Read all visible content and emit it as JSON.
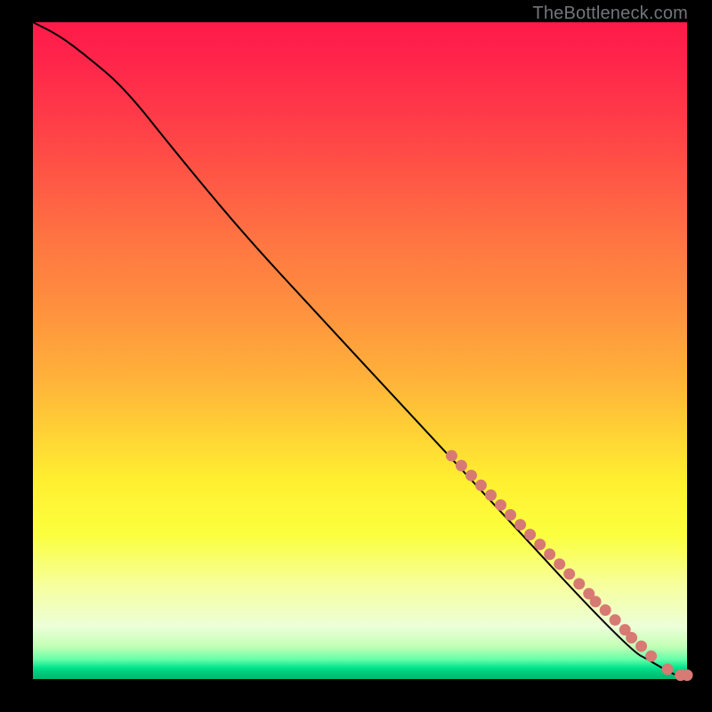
{
  "attribution": "TheBottleneck.com",
  "chart_data": {
    "type": "line",
    "title": "",
    "xlabel": "",
    "ylabel": "",
    "xlim": [
      0,
      100
    ],
    "ylim": [
      0,
      100
    ],
    "series": [
      {
        "name": "curve",
        "x": [
          0,
          4,
          8,
          14,
          22,
          32,
          44,
          58,
          72,
          84,
          92,
          94,
          96,
          98,
          99,
          100
        ],
        "y": [
          100,
          98,
          95,
          90,
          80,
          68,
          55,
          40,
          25,
          12,
          4,
          3,
          1.8,
          0.7,
          0.5,
          0.5
        ]
      }
    ],
    "markers": {
      "name": "highlighted-points",
      "x": [
        64,
        65.5,
        67,
        68.5,
        70,
        71.5,
        73,
        74.5,
        76,
        77.5,
        79,
        80.5,
        82,
        83.5,
        85,
        86,
        87.5,
        89,
        90.5,
        91.5,
        93,
        94.5,
        97,
        99,
        100
      ],
      "y": [
        34,
        32.5,
        31,
        29.5,
        28,
        26.5,
        25,
        23.5,
        22,
        20.5,
        19,
        17.5,
        16,
        14.5,
        13,
        11.8,
        10.5,
        9,
        7.5,
        6.3,
        5,
        3.5,
        1.5,
        0.6,
        0.6
      ]
    },
    "gradient_note": "background encodes value: red high, green low"
  }
}
